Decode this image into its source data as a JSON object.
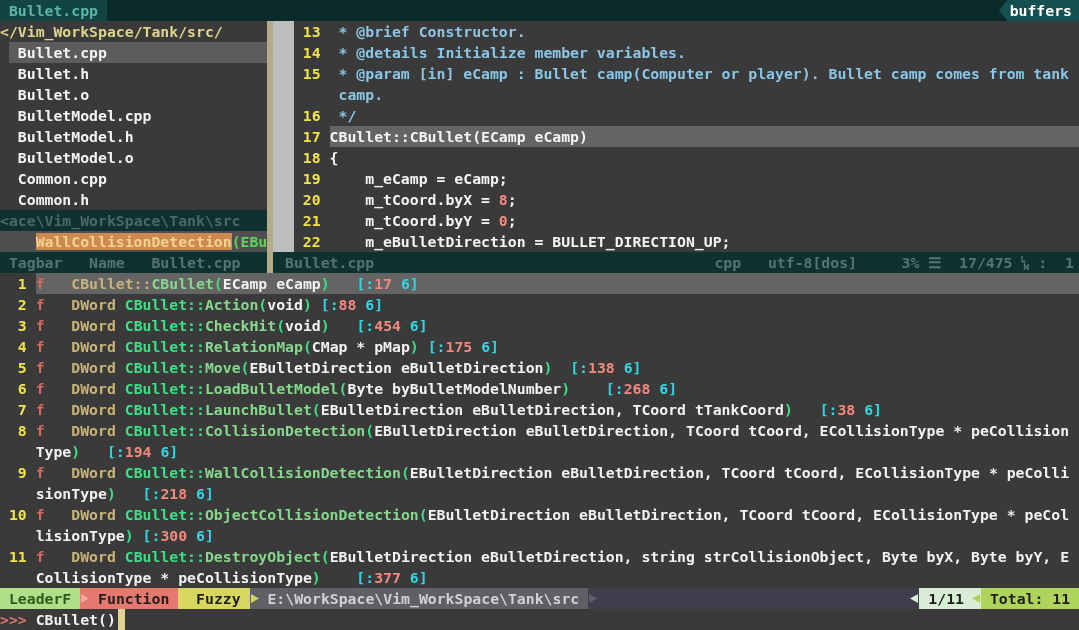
{
  "tabline": {
    "tabs": [
      {
        "label": "Bullet.cpp",
        "selected": true
      }
    ],
    "buffers_label": "buffers"
  },
  "file_tree": {
    "root": "</Vim_WorkSpace/Tank/src/",
    "files": [
      {
        "name": "Bullet.cpp",
        "selected": true
      },
      {
        "name": "Bullet.h",
        "selected": false
      },
      {
        "name": "Bullet.o",
        "selected": false
      },
      {
        "name": "BulletModel.cpp",
        "selected": false
      },
      {
        "name": "BulletModel.h",
        "selected": false
      },
      {
        "name": "BulletModel.o",
        "selected": false
      },
      {
        "name": "Common.cpp",
        "selected": false
      },
      {
        "name": "Common.h",
        "selected": false
      }
    ],
    "status": "<ace\\Vim_WorkSpace\\Tank\\src"
  },
  "tagbar": {
    "match": "WallCollisionDetection",
    "rest": "(EBu"
  },
  "tagbar_status": {
    "title": "Tagbar",
    "sort": "Name",
    "file": "Bullet.cpp"
  },
  "editor": {
    "lines": [
      {
        "number": "13",
        "current": false,
        "segments": [
          {
            "kind": "comment",
            "text": " * @brief Constructor."
          }
        ]
      },
      {
        "number": "14",
        "current": false,
        "segments": [
          {
            "kind": "comment",
            "text": " * @details Initialize member variables."
          }
        ]
      },
      {
        "number": "15",
        "current": false,
        "segments": [
          {
            "kind": "comment",
            "text": " * @param [in] eCamp : Bullet camp(Computer or player). Bullet camp comes from tank"
          }
        ],
        "continuation": [
          {
            "kind": "comment",
            "text": "camp."
          }
        ]
      },
      {
        "number": "16",
        "current": false,
        "segments": [
          {
            "kind": "comment",
            "text": " */"
          }
        ]
      },
      {
        "number": "17",
        "current": true,
        "segments": [
          {
            "kind": "code",
            "text": "CBullet::CBullet(ECamp eCamp)"
          }
        ]
      },
      {
        "number": "18",
        "current": false,
        "segments": [
          {
            "kind": "code",
            "text": "{"
          }
        ]
      },
      {
        "number": "19",
        "current": false,
        "segments": [
          {
            "kind": "code",
            "text": "    m_eCamp = eCamp;"
          }
        ]
      },
      {
        "number": "20",
        "current": false,
        "segments": [
          {
            "kind": "code",
            "text": "    m_tCoord.byX = "
          },
          {
            "kind": "number",
            "text": "8"
          },
          {
            "kind": "code",
            "text": ";"
          }
        ]
      },
      {
        "number": "21",
        "current": false,
        "segments": [
          {
            "kind": "code",
            "text": "    m_tCoord.byY = "
          },
          {
            "kind": "number",
            "text": "0"
          },
          {
            "kind": "code",
            "text": ";"
          }
        ]
      },
      {
        "number": "22",
        "current": false,
        "segments": [
          {
            "kind": "code",
            "text": "    m_eBulletDirection = BULLET_DIRECTION_UP;"
          }
        ]
      }
    ]
  },
  "status_line": {
    "file": "Bullet.cpp",
    "filetype": "cpp",
    "encoding": "utf-8[dos]",
    "percent": "3%",
    "lines_symbol": "☰",
    "position": "17/475",
    "column_separator": ":",
    "column": "1"
  },
  "results": {
    "rows": [
      {
        "number": "1",
        "tag": "f",
        "selected": true,
        "lines": [
          [
            {
              "kind": "type",
              "text": "CBullet::"
            },
            {
              "kind": "name",
              "text": "CBullet"
            },
            {
              "kind": "paren",
              "text": "("
            },
            {
              "kind": "param",
              "text": "ECamp eCamp"
            },
            {
              "kind": "paren",
              "text": ")"
            },
            {
              "kind": "bracket",
              "text": "   [:"
            },
            {
              "kind": "line_no",
              "text": "17"
            },
            {
              "kind": "bracket",
              "text": " 6]"
            }
          ]
        ]
      },
      {
        "number": "2",
        "tag": "f",
        "selected": false,
        "lines": [
          [
            {
              "kind": "type",
              "text": "DWord "
            },
            {
              "kind": "scope",
              "text": "CBullet::"
            },
            {
              "kind": "name",
              "text": "Action"
            },
            {
              "kind": "paren",
              "text": "("
            },
            {
              "kind": "param",
              "text": "void"
            },
            {
              "kind": "paren",
              "text": ")"
            },
            {
              "kind": "bracket",
              "text": " [:"
            },
            {
              "kind": "line_no",
              "text": "88"
            },
            {
              "kind": "bracket",
              "text": " 6]"
            }
          ]
        ]
      },
      {
        "number": "3",
        "tag": "f",
        "selected": false,
        "lines": [
          [
            {
              "kind": "type",
              "text": "DWord "
            },
            {
              "kind": "scope",
              "text": "CBullet::"
            },
            {
              "kind": "name",
              "text": "CheckHit"
            },
            {
              "kind": "paren",
              "text": "("
            },
            {
              "kind": "param",
              "text": "void"
            },
            {
              "kind": "paren",
              "text": ")"
            },
            {
              "kind": "bracket",
              "text": "   [:"
            },
            {
              "kind": "line_no",
              "text": "454"
            },
            {
              "kind": "bracket",
              "text": " 6]"
            }
          ]
        ]
      },
      {
        "number": "4",
        "tag": "f",
        "selected": false,
        "lines": [
          [
            {
              "kind": "type",
              "text": "DWord "
            },
            {
              "kind": "scope",
              "text": "CBullet::"
            },
            {
              "kind": "name",
              "text": "RelationMap"
            },
            {
              "kind": "paren",
              "text": "("
            },
            {
              "kind": "param",
              "text": "CMap * pMap"
            },
            {
              "kind": "paren",
              "text": ")"
            },
            {
              "kind": "bracket",
              "text": " [:"
            },
            {
              "kind": "line_no",
              "text": "175"
            },
            {
              "kind": "bracket",
              "text": " 6]"
            }
          ]
        ]
      },
      {
        "number": "5",
        "tag": "f",
        "selected": false,
        "lines": [
          [
            {
              "kind": "type",
              "text": "DWord "
            },
            {
              "kind": "scope",
              "text": "CBullet::"
            },
            {
              "kind": "name",
              "text": "Move"
            },
            {
              "kind": "paren",
              "text": "("
            },
            {
              "kind": "param",
              "text": "EBulletDirection eBulletDirection"
            },
            {
              "kind": "paren",
              "text": ")"
            },
            {
              "kind": "bracket",
              "text": "  [:"
            },
            {
              "kind": "line_no",
              "text": "138"
            },
            {
              "kind": "bracket",
              "text": " 6]"
            }
          ]
        ]
      },
      {
        "number": "6",
        "tag": "f",
        "selected": false,
        "lines": [
          [
            {
              "kind": "type",
              "text": "DWord "
            },
            {
              "kind": "scope",
              "text": "CBullet::"
            },
            {
              "kind": "name",
              "text": "LoadBulletModel"
            },
            {
              "kind": "paren",
              "text": "("
            },
            {
              "kind": "param",
              "text": "Byte byBulletModelNumber"
            },
            {
              "kind": "paren",
              "text": ")"
            },
            {
              "kind": "bracket",
              "text": "    [:"
            },
            {
              "kind": "line_no",
              "text": "268"
            },
            {
              "kind": "bracket",
              "text": " 6]"
            }
          ]
        ]
      },
      {
        "number": "7",
        "tag": "f",
        "selected": false,
        "lines": [
          [
            {
              "kind": "type",
              "text": "DWord "
            },
            {
              "kind": "scope",
              "text": "CBullet::"
            },
            {
              "kind": "name",
              "text": "LaunchBullet"
            },
            {
              "kind": "paren",
              "text": "("
            },
            {
              "kind": "param",
              "text": "EBulletDirection eBulletDirection, TCoord tTankCoord"
            },
            {
              "kind": "paren",
              "text": ")"
            },
            {
              "kind": "bracket",
              "text": "   [:"
            },
            {
              "kind": "line_no",
              "text": "38"
            },
            {
              "kind": "bracket",
              "text": " 6]"
            }
          ]
        ]
      },
      {
        "number": "8",
        "tag": "f",
        "selected": false,
        "lines": [
          [
            {
              "kind": "type",
              "text": "DWord "
            },
            {
              "kind": "scope",
              "text": "CBullet::"
            },
            {
              "kind": "name",
              "text": "CollisionDetection"
            },
            {
              "kind": "paren",
              "text": "("
            },
            {
              "kind": "param",
              "text": "EBulletDirection eBulletDirection, TCoord tCoord, ECollisionType * peCollision"
            }
          ],
          [
            {
              "kind": "param",
              "text": "Type"
            },
            {
              "kind": "paren",
              "text": ")"
            },
            {
              "kind": "bracket",
              "text": "   [:"
            },
            {
              "kind": "line_no",
              "text": "194"
            },
            {
              "kind": "bracket",
              "text": " 6]"
            }
          ]
        ]
      },
      {
        "number": "9",
        "tag": "f",
        "selected": false,
        "lines": [
          [
            {
              "kind": "type",
              "text": "DWord "
            },
            {
              "kind": "scope",
              "text": "CBullet::"
            },
            {
              "kind": "name",
              "text": "WallCollisionDetection"
            },
            {
              "kind": "paren",
              "text": "("
            },
            {
              "kind": "param",
              "text": "EBulletDirection eBulletDirection, TCoord tCoord, ECollisionType * peColli"
            }
          ],
          [
            {
              "kind": "param",
              "text": "sionType"
            },
            {
              "kind": "paren",
              "text": ")"
            },
            {
              "kind": "bracket",
              "text": "   [:"
            },
            {
              "kind": "line_no",
              "text": "218"
            },
            {
              "kind": "bracket",
              "text": " 6]"
            }
          ]
        ]
      },
      {
        "number": "10",
        "tag": "f",
        "selected": false,
        "lines": [
          [
            {
              "kind": "type",
              "text": "DWord "
            },
            {
              "kind": "scope",
              "text": "CBullet::"
            },
            {
              "kind": "name",
              "text": "ObjectCollisionDetection"
            },
            {
              "kind": "paren",
              "text": "("
            },
            {
              "kind": "param",
              "text": "EBulletDirection eBulletDirection, TCoord tCoord, ECollisionType * peCol"
            }
          ],
          [
            {
              "kind": "param",
              "text": "lisionType"
            },
            {
              "kind": "paren",
              "text": ")"
            },
            {
              "kind": "bracket",
              "text": " [:"
            },
            {
              "kind": "line_no",
              "text": "300"
            },
            {
              "kind": "bracket",
              "text": " 6]"
            }
          ]
        ]
      },
      {
        "number": "11",
        "tag": "f",
        "selected": false,
        "lines": [
          [
            {
              "kind": "type",
              "text": "DWord "
            },
            {
              "kind": "scope",
              "text": "CBullet::"
            },
            {
              "kind": "name",
              "text": "DestroyObject"
            },
            {
              "kind": "paren",
              "text": "("
            },
            {
              "kind": "param",
              "text": "EBulletDirection eBulletDirection, string strCollisionObject, Byte byX, Byte byY, E"
            }
          ],
          [
            {
              "kind": "param",
              "text": "CollisionType * peCollisionType"
            },
            {
              "kind": "paren",
              "text": ")"
            },
            {
              "kind": "bracket",
              "text": "    [:"
            },
            {
              "kind": "line_no",
              "text": "377"
            },
            {
              "kind": "bracket",
              "text": " 6]"
            }
          ]
        ]
      }
    ]
  },
  "leaderf_bar": {
    "mode": "LeaderF",
    "category": "Function",
    "match_mode": "Fuzzy",
    "path": "E:\\WorkSpace\\Vim_WorkSpace\\Tank\\src",
    "count": "1/11",
    "total": "Total: 11"
  },
  "prompt": {
    "symbol": ">>>",
    "value": "CBullet()"
  }
}
